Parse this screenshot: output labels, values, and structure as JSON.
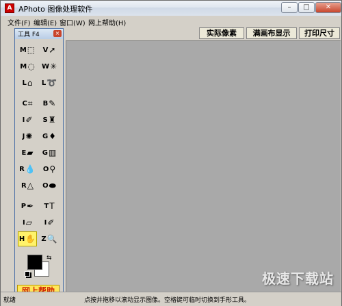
{
  "window": {
    "title": "APhoto 图像处理软件",
    "icon_letter": "A",
    "min": "–",
    "max": "□",
    "close": "✕"
  },
  "menu": [
    {
      "label": "文件(F)"
    },
    {
      "label": "编辑(E)"
    },
    {
      "label": "窗口(W)"
    },
    {
      "label": "网上帮助(H)"
    }
  ],
  "top_buttons": [
    "实际像素",
    "满画布显示",
    "打印尺寸"
  ],
  "toolbox": {
    "title": "工具 F4",
    "close": "×",
    "tools": [
      {
        "letter": "M",
        "icon": "rect-marquee-icon",
        "glyph": "⬚"
      },
      {
        "letter": "V",
        "icon": "move-icon",
        "glyph": "➚"
      },
      {
        "letter": "M",
        "icon": "ellipse-marquee-icon",
        "glyph": "◌"
      },
      {
        "letter": "W",
        "icon": "magic-wand-icon",
        "glyph": "✳"
      },
      {
        "letter": "L",
        "icon": "polygon-lasso-icon",
        "glyph": "⌂"
      },
      {
        "letter": "L",
        "icon": "lasso-icon",
        "glyph": "➰"
      },
      {
        "letter": "C",
        "icon": "crop-icon",
        "glyph": "⌗"
      },
      {
        "letter": "B",
        "icon": "brush-icon",
        "glyph": "✎"
      },
      {
        "letter": "I",
        "icon": "eyedropper-icon",
        "glyph": "✐"
      },
      {
        "letter": "S",
        "icon": "stamp-icon",
        "glyph": "♜"
      },
      {
        "letter": "J",
        "icon": "healing-icon",
        "glyph": "✺"
      },
      {
        "letter": "G",
        "icon": "paint-bucket-icon",
        "glyph": "♦"
      },
      {
        "letter": "E",
        "icon": "eraser-icon",
        "glyph": "▰"
      },
      {
        "letter": "G",
        "icon": "gradient-icon",
        "glyph": "▥"
      },
      {
        "letter": "R",
        "icon": "blur-icon",
        "glyph": "💧"
      },
      {
        "letter": "O",
        "icon": "dodge-icon",
        "glyph": "⚲"
      },
      {
        "letter": "R",
        "icon": "sharpen-icon",
        "glyph": "△"
      },
      {
        "letter": "O",
        "icon": "sponge-icon",
        "glyph": "⬬"
      },
      {
        "letter": "P",
        "icon": "pen-icon",
        "glyph": "✒"
      },
      {
        "letter": "T",
        "icon": "text-icon",
        "glyph": "T"
      },
      {
        "letter": "I",
        "icon": "measure-icon",
        "glyph": "▱"
      },
      {
        "letter": "I",
        "icon": "color-sampler-icon",
        "glyph": "✐"
      },
      {
        "letter": "H",
        "icon": "hand-icon",
        "glyph": "✋"
      },
      {
        "letter": "Z",
        "icon": "zoom-icon",
        "glyph": "🔍"
      }
    ],
    "help_button": "网上帮助"
  },
  "status": {
    "left": "就绪",
    "hint": "点按并拖移以滚动显示图像。空格键可临时切换到手形工具。"
  },
  "watermark": "极速下载站",
  "colors": {
    "foreground": "#000000",
    "background": "#ffffff",
    "canvas": "#a9a9a9",
    "active_tool": "#fff26a"
  }
}
